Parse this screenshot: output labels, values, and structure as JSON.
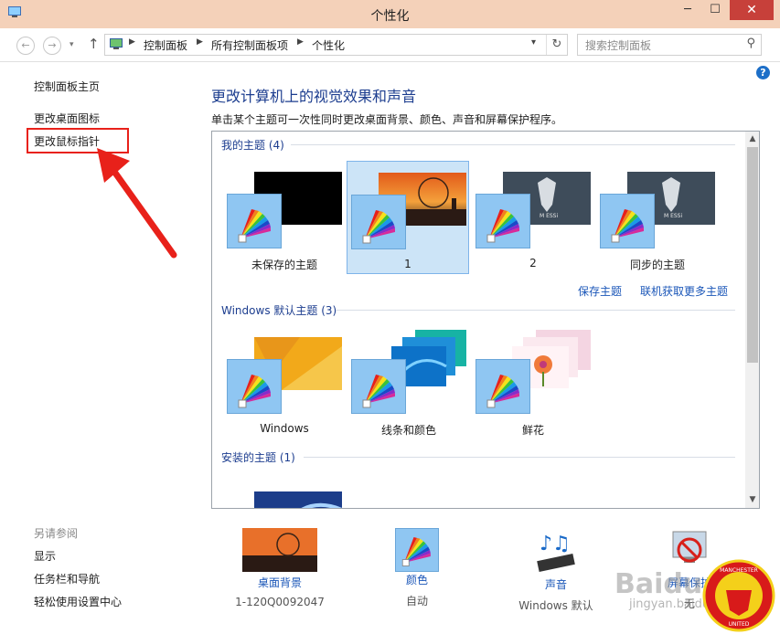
{
  "window": {
    "title": "个性化"
  },
  "titlebar": {
    "minimize": "─",
    "maximize": "☐",
    "close": "✕"
  },
  "address": {
    "crumbs": [
      "控制面板",
      "所有控制面板项",
      "个性化"
    ],
    "search_placeholder": "搜索控制面板"
  },
  "sidebar": {
    "home": "控制面板主页",
    "links": [
      "更改桌面图标",
      "更改鼠标指针"
    ],
    "see_also_header": "另请参阅",
    "see_also": [
      "显示",
      "任务栏和导航",
      "轻松使用设置中心"
    ]
  },
  "main": {
    "title": "更改计算机上的视觉效果和声音",
    "description": "单击某个主题可一次性同时更改桌面背景、颜色、声音和屏幕保护程序。"
  },
  "themes": {
    "my_header": "我的主题 (4)",
    "my_themes": [
      {
        "label": "未保存的主题",
        "thumb": "black"
      },
      {
        "label": "1",
        "thumb": "sunset"
      },
      {
        "label": "2",
        "thumb": "messi"
      },
      {
        "label": "同步的主题",
        "thumb": "messi"
      }
    ],
    "selected_index": 1,
    "save_link": "保存主题",
    "online_link": "联机获取更多主题",
    "default_header": "Windows 默认主题 (3)",
    "default_themes": [
      {
        "label": "Windows",
        "thumb": "win8"
      },
      {
        "label": "线条和颜色",
        "thumb": "lines"
      },
      {
        "label": "鲜花",
        "thumb": "flowers"
      }
    ],
    "installed_header": "安装的主题 (1)"
  },
  "bottom": [
    {
      "title": "桌面背景",
      "sub": "1-120Q0092047",
      "icon": "wallpaper-thumbnail"
    },
    {
      "title": "颜色",
      "sub": "自动",
      "icon": "color-fan-icon"
    },
    {
      "title": "声音",
      "sub": "Windows 默认",
      "icon": "music-notes-icon"
    },
    {
      "title": "屏幕保护",
      "sub": "无",
      "icon": "screensaver-icon"
    }
  ],
  "watermark": {
    "text": "Baidu 经验",
    "url_text": "jingyan.baidu.com",
    "crest_text": "MANCHESTER UNITED"
  },
  "colors": {
    "accent": "#1c3d8f",
    "link": "#1a56b8",
    "titlebar": "#f4d1b9",
    "close": "#c7403a",
    "highlight": "#e8211a"
  }
}
